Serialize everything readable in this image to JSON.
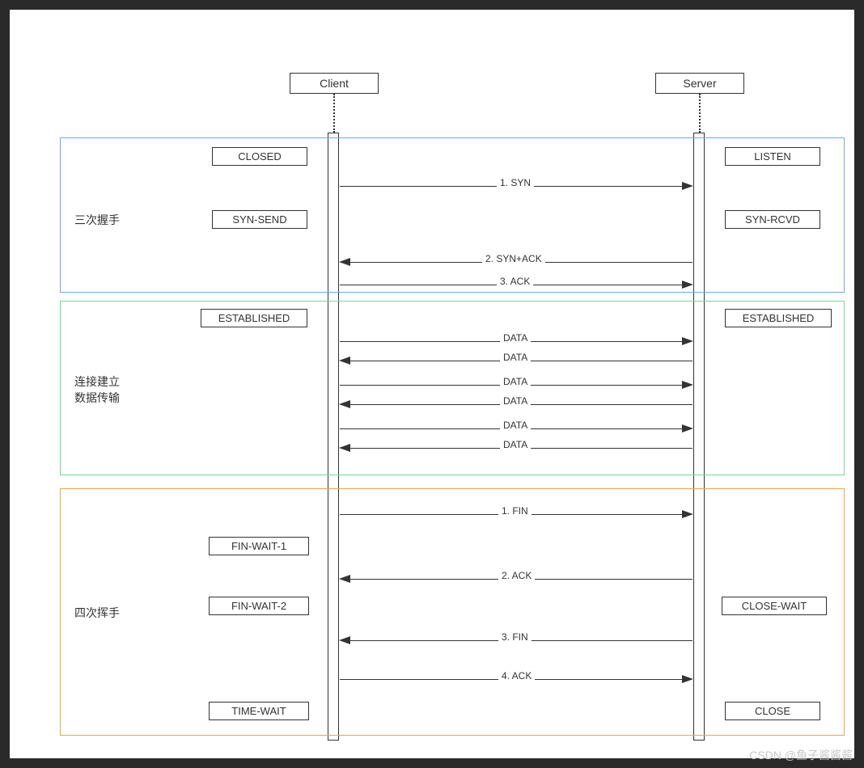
{
  "participants": {
    "client": "Client",
    "server": "Server"
  },
  "phases": {
    "handshake": {
      "label": "三次握手",
      "color": "#6aa8ff"
    },
    "transfer": {
      "label_line1": "连接建立",
      "label_line2": "数据传输",
      "color": "#6fdc9b"
    },
    "close": {
      "label": "四次挥手",
      "color": "#f0a447"
    }
  },
  "states": {
    "client": [
      "CLOSED",
      "SYN-SEND",
      "ESTABLISHED",
      "FIN-WAIT-1",
      "FIN-WAIT-2",
      "TIME-WAIT"
    ],
    "server": [
      "LISTEN",
      "SYN-RCVD",
      "ESTABLISHED",
      "CLOSE-WAIT",
      "CLOSE"
    ]
  },
  "messages": {
    "handshake": [
      {
        "dir": "right",
        "label": "1. SYN"
      },
      {
        "dir": "left",
        "label": "2. SYN+ACK"
      },
      {
        "dir": "right",
        "label": "3. ACK"
      }
    ],
    "transfer": [
      {
        "dir": "right",
        "label": "DATA"
      },
      {
        "dir": "left",
        "label": "DATA"
      },
      {
        "dir": "right",
        "label": "DATA"
      },
      {
        "dir": "left",
        "label": "DATA"
      },
      {
        "dir": "right",
        "label": "DATA"
      },
      {
        "dir": "left",
        "label": "DATA"
      }
    ],
    "close": [
      {
        "dir": "right",
        "label": "1. FIN"
      },
      {
        "dir": "left",
        "label": "2. ACK"
      },
      {
        "dir": "left",
        "label": "3. FIN"
      },
      {
        "dir": "right",
        "label": "4. ACK"
      }
    ]
  },
  "watermark": "CSDN @鱼子酱酱酱"
}
